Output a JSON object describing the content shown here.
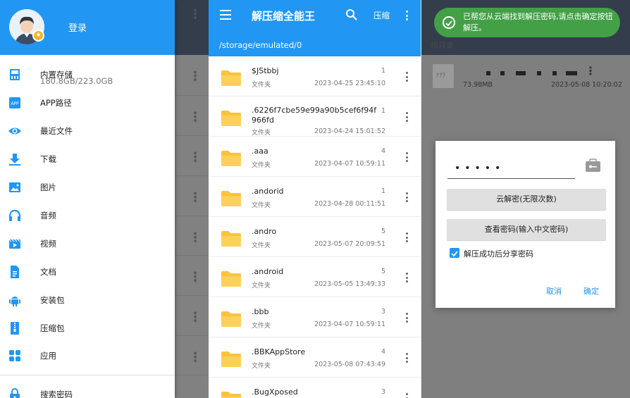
{
  "drawer": {
    "login_label": "登录",
    "items": [
      {
        "label": "内置存储",
        "sub": "180.8GB/223.0GB",
        "icon": "storage-icon"
      },
      {
        "label": "APP路径",
        "icon": "app-icon"
      },
      {
        "label": "最近文件",
        "icon": "eye-icon"
      },
      {
        "label": "下载",
        "icon": "download-icon"
      },
      {
        "label": "图片",
        "icon": "image-icon"
      },
      {
        "label": "音频",
        "icon": "headphones-icon"
      },
      {
        "label": "视频",
        "icon": "video-icon"
      },
      {
        "label": "文档",
        "icon": "document-icon"
      },
      {
        "label": "安装包",
        "icon": "android-icon"
      },
      {
        "label": "压缩包",
        "icon": "zip-icon"
      },
      {
        "label": "应用",
        "icon": "apps-icon"
      },
      {
        "label": "搜索密码",
        "icon": "lock-icon"
      }
    ]
  },
  "browser": {
    "title": "解压缩全能王",
    "zip_label": "压缩",
    "path": "/storage/emulated/0",
    "files": [
      {
        "name": "$JStbbj",
        "type": "文件夹",
        "count": "1",
        "date": "2023-04-25 23:45:10"
      },
      {
        "name": ".6226f7cbe59e99a90b5cef6f94f966fd",
        "type": "文件夹",
        "count": "1",
        "date": "2023-04-24 15:01:52"
      },
      {
        "name": ".aaa",
        "type": "文件夹",
        "count": "4",
        "date": "2023-04-07 10:59:11"
      },
      {
        "name": ".andorid",
        "type": "文件夹",
        "count": "1",
        "date": "2023-04-28 00:11:51"
      },
      {
        "name": ".andro",
        "type": "文件夹",
        "count": "5",
        "date": "2023-05-07 20:09:51"
      },
      {
        "name": ".android",
        "type": "文件夹",
        "count": "5",
        "date": "2023-05-05 13:49:33"
      },
      {
        "name": ".bbb",
        "type": "文件夹",
        "count": "3",
        "date": "2023-04-07 10:59:11"
      },
      {
        "name": ".BBKAppStore",
        "type": "文件夹",
        "count": "4",
        "date": "2023-05-08 07:43:49"
      },
      {
        "name": ".BugXposed",
        "type": "",
        "count": "3",
        "date": ""
      }
    ]
  },
  "extract": {
    "toast": "已帮您从云端找到解压密码,请点击确定按钮解压。",
    "root_label": "根目录",
    "file_icon_text": "???",
    "file_size": "73.98MB",
    "file_date": "2023-05-08 10:20:02",
    "password": "•••••",
    "cloud_button": "云解密(无限次数)",
    "view_button": "查看密码(输入中文密码)",
    "share_checkbox_label": "解压成功后分享密码",
    "share_checked": true,
    "cancel_label": "取消",
    "ok_label": "确定"
  },
  "colors": {
    "primary": "#2196f3",
    "folder": "#f9c33c",
    "toast": "#43a047"
  }
}
